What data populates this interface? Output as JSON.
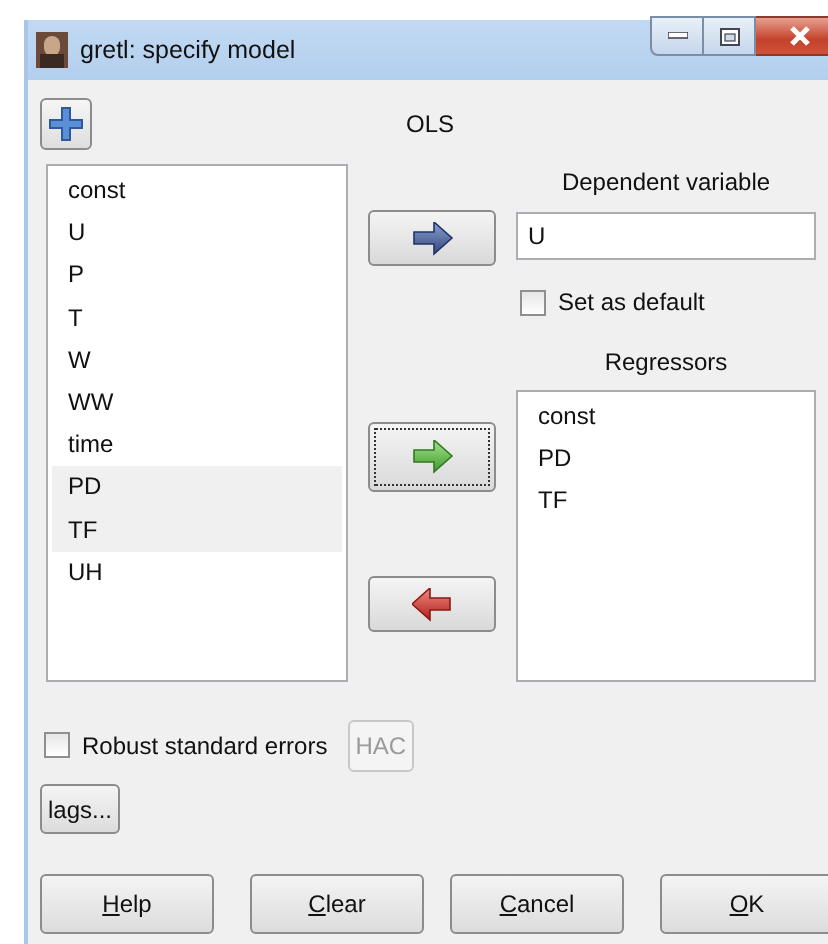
{
  "window": {
    "title": "gretl: specify model"
  },
  "estimator": "OLS",
  "variables": [
    {
      "name": "const",
      "selected": false
    },
    {
      "name": "U",
      "selected": false
    },
    {
      "name": "P",
      "selected": false
    },
    {
      "name": "T",
      "selected": false
    },
    {
      "name": "W",
      "selected": false
    },
    {
      "name": "WW",
      "selected": false
    },
    {
      "name": "time",
      "selected": false
    },
    {
      "name": "PD",
      "selected": true
    },
    {
      "name": "TF",
      "selected": true
    },
    {
      "name": "UH",
      "selected": false
    }
  ],
  "arrow_buttons": [
    {
      "kind": "add_dependent",
      "focused": false
    },
    {
      "kind": "add_regressor",
      "focused": true
    },
    {
      "kind": "remove",
      "focused": false
    }
  ],
  "dependent_variable": {
    "label": "Dependent variable",
    "value": "U"
  },
  "set_as_default": {
    "label": "Set as default",
    "checked": false
  },
  "regressors": {
    "label": "Regressors",
    "items": [
      "const",
      "PD",
      "TF"
    ]
  },
  "robust": {
    "label": "Robust standard errors",
    "checked": false
  },
  "hac_button": {
    "label": "HAC",
    "disabled": true
  },
  "lags_button": {
    "label": "lags..."
  },
  "buttons": [
    "Help",
    "Clear",
    "Cancel",
    "OK"
  ]
}
